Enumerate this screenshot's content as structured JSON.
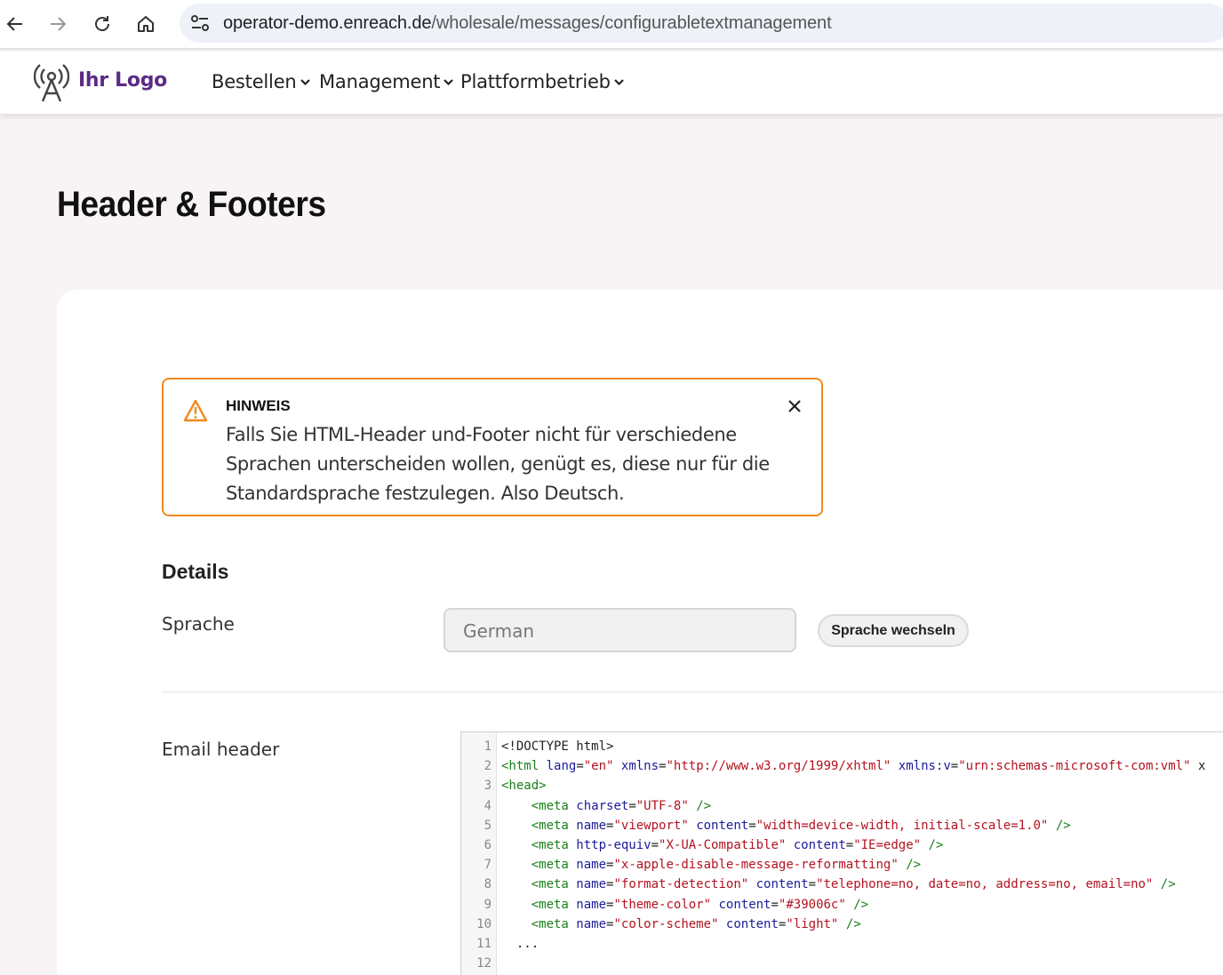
{
  "browser": {
    "url_host": "operator-demo.enreach.de",
    "url_path": "/wholesale/messages/configurabletextmanagement"
  },
  "header": {
    "logo_text": "Ihr Logo",
    "menu": [
      {
        "label": "Bestellen"
      },
      {
        "label": "Management"
      },
      {
        "label": "Plattformbetrieb"
      }
    ]
  },
  "page": {
    "title": "Header & Footers"
  },
  "notice": {
    "title": "HINWEIS",
    "body": "Falls Sie HTML-Header und-Footer nicht für verschiedene Sprachen unterscheiden wollen, genügt es, diese nur für die Standardsprache festzulegen. Also Deutsch."
  },
  "details": {
    "title": "Details",
    "language_label": "Sprache",
    "language_value": "German",
    "switch_label": "Sprache wechseln",
    "email_header_label": "Email header"
  },
  "editor": {
    "lines": [
      {
        "n": "1",
        "t": "<!DOCTYPE html>"
      },
      {
        "n": "2",
        "t": "<html lang=\"en\" xmlns=\"http://www.w3.org/1999/xhtml\" xmlns:v=\"urn:schemas-microsoft-com:vml\" x"
      },
      {
        "n": "3",
        "t": "<head>"
      },
      {
        "n": "4",
        "t": "    <meta charset=\"UTF-8\" />"
      },
      {
        "n": "5",
        "t": "    <meta name=\"viewport\" content=\"width=device-width, initial-scale=1.0\" />"
      },
      {
        "n": "6",
        "t": "    <meta http-equiv=\"X-UA-Compatible\" content=\"IE=edge\" />"
      },
      {
        "n": "7",
        "t": "    <meta name=\"x-apple-disable-message-reformatting\" />"
      },
      {
        "n": "8",
        "t": "    <meta name=\"format-detection\" content=\"telephone=no, date=no, address=no, email=no\" />"
      },
      {
        "n": "9",
        "t": "    <meta name=\"theme-color\" content=\"#39006c\" />"
      },
      {
        "n": "10",
        "t": "    <meta name=\"color-scheme\" content=\"light\" />"
      },
      {
        "n": "11",
        "t": "  ..."
      },
      {
        "n": "12",
        "t": ""
      }
    ]
  },
  "colors": {
    "accent_warning": "#ef8a1f",
    "brand_purple": "#5b2a86"
  },
  "icons": {
    "back": "arrow-left-icon",
    "forward": "arrow-right-icon",
    "reload": "reload-icon",
    "home": "home-icon",
    "site_settings": "tune-icon",
    "logo": "antenna-icon",
    "warning": "warning-triangle-icon",
    "close": "close-icon"
  }
}
